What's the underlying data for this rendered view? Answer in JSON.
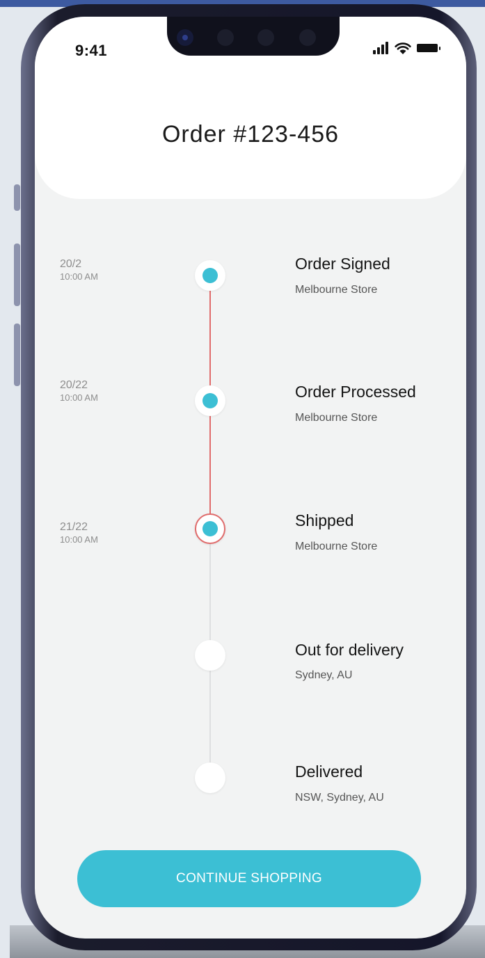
{
  "status_bar": {
    "time": "9:41",
    "icons": [
      "signal-icon",
      "wifi-icon",
      "battery-icon"
    ]
  },
  "header": {
    "title": "Order  #123-456"
  },
  "timeline": {
    "steps": [
      {
        "date": "20/2",
        "time": "10:00 AM",
        "title": "Order Signed",
        "location": "Melbourne Store",
        "state": "done"
      },
      {
        "date": "20/22",
        "time": "10:00 AM",
        "title": "Order Processed",
        "location": "Melbourne Store",
        "state": "done"
      },
      {
        "date": "21/22",
        "time": "10:00 AM",
        "title": "Shipped",
        "location": "Melbourne Store",
        "state": "current"
      },
      {
        "date": "",
        "time": "",
        "title": "Out for delivery",
        "location": "Sydney, AU",
        "state": "pending"
      },
      {
        "date": "",
        "time": "",
        "title": "Delivered",
        "location": "NSW, Sydney, AU",
        "state": "pending"
      }
    ]
  },
  "cta": {
    "label": "CONTINUE SHOPPING"
  },
  "colors": {
    "accent": "#3cbfd4",
    "progress_line": "#e06b6b",
    "pending_line": "#dedfe0",
    "background": "#f2f3f3"
  }
}
